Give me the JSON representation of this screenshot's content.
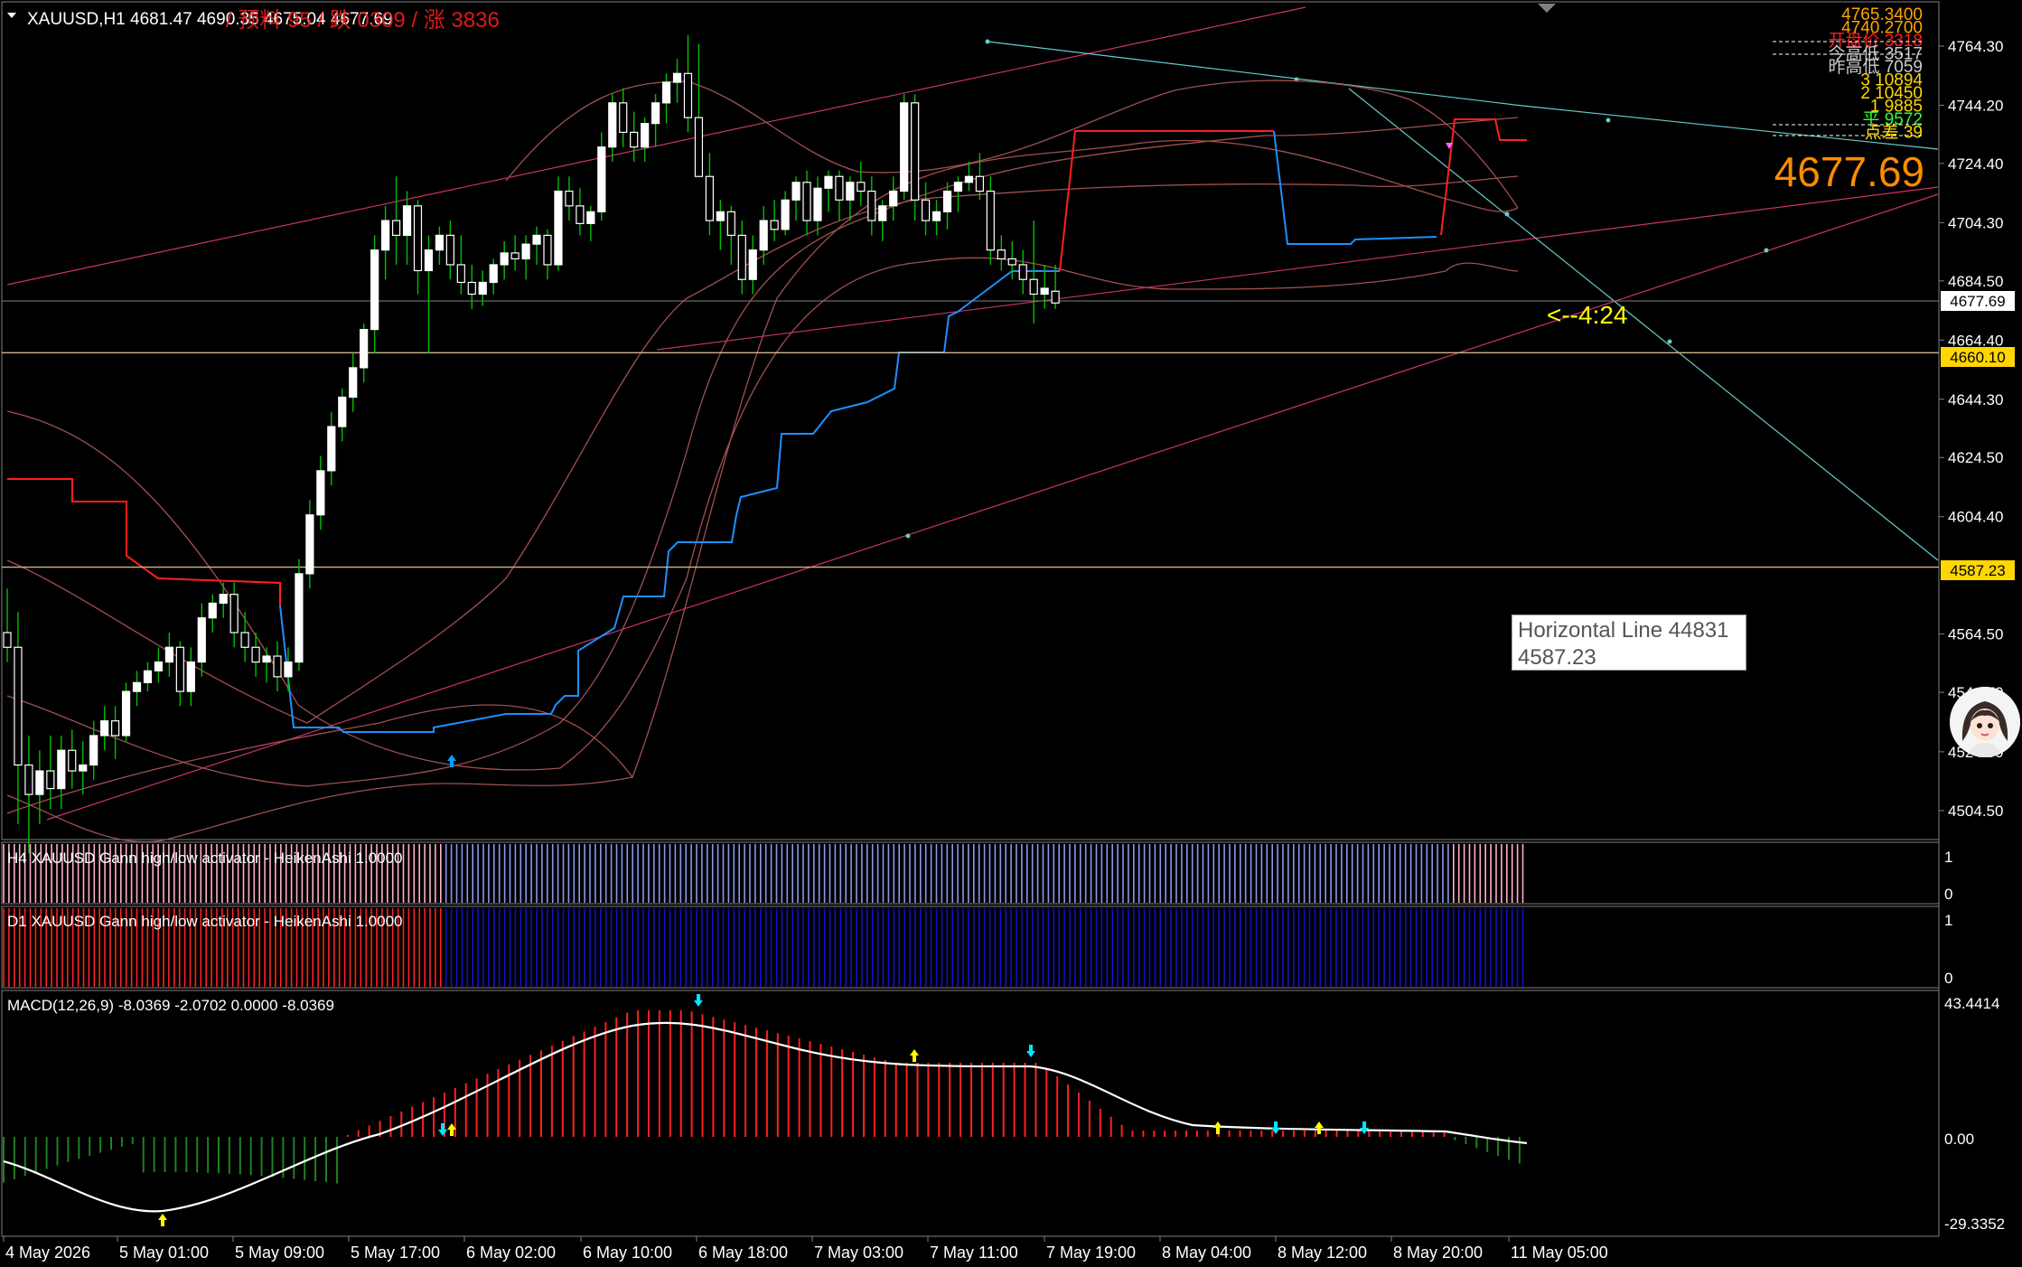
{
  "window": {
    "symbol_info": "XAUUSD,H1  4681.47 4690.35 4675.04 4677.69",
    "overlay_text_red": "/ 预料 95 / 跌 0309 / 涨 3836",
    "current_price_big": "4677.69",
    "countdown": "<--4:24"
  },
  "info_panel": {
    "lines": [
      {
        "text": "4765.3400",
        "color": "#ffa500"
      },
      {
        "text": "4740.2700",
        "color": "#ffa500"
      },
      {
        "text": "开盘价 3318",
        "color": "#ff2020"
      },
      {
        "text": "今高低 3517",
        "color": "#cccccc"
      },
      {
        "text": "昨高低 7059",
        "color": "#cccccc"
      },
      {
        "text": "3 10894",
        "color": "#ffd700"
      },
      {
        "text": "2 10450",
        "color": "#ffd700"
      },
      {
        "text": "1 9885",
        "color": "#ffd700"
      },
      {
        "text": "平 9572",
        "color": "#33ff33"
      },
      {
        "text": "点差 39",
        "color": "#ffd700"
      }
    ]
  },
  "price_axis": {
    "labels": [
      "4764.30",
      "4744.20",
      "4724.40",
      "4704.30",
      "4684.50",
      "4664.40",
      "4644.30",
      "4624.50",
      "4604.40",
      "4564.50",
      "4544.70",
      "4524.50",
      "4504.50"
    ],
    "current_tag": "4677.69",
    "hline1_tag": "4660.10",
    "hline2_tag": "4587.23"
  },
  "tooltip": {
    "line1": "Horizontal Line 44831",
    "line2": "4587.23"
  },
  "indicator_h4": {
    "label": "H4 XAUUSD Gann high/low activator - HeikenAshi 1.0000",
    "axis_top": "1",
    "axis_bottom": "0"
  },
  "indicator_d1": {
    "label": "D1 XAUUSD Gann high/low activator - HeikenAshi 1.0000",
    "axis_top": "1",
    "axis_bottom": "0"
  },
  "macd": {
    "label": "MACD(12,26,9) -8.0369 -2.0702 0.0000 -8.0369",
    "axis_top": "43.4414",
    "axis_mid": "0.00",
    "axis_bottom": "-29.3352"
  },
  "time_axis": [
    "4 May 2026",
    "5 May 01:00",
    "5 May 09:00",
    "5 May 17:00",
    "6 May 02:00",
    "6 May 10:00",
    "6 May 18:00",
    "7 May 03:00",
    "7 May 11:00",
    "7 May 19:00",
    "8 May 04:00",
    "8 May 12:00",
    "8 May 20:00",
    "11 May 05:00"
  ],
  "colors": {
    "bull": "#ffffff",
    "bear": "#ffffff",
    "wick": "#00c000",
    "red_line": "#ff2020",
    "blue_line": "#1e90ff",
    "boll": "#a05050",
    "grid_line": "#808080",
    "hline": "#d2b48c",
    "trend_pink": "#cc3366",
    "trend_cyan": "#66cccc",
    "macd_pos": "#ff2020",
    "macd_neg": "#208020"
  },
  "chart_data": {
    "type": "candlestick",
    "candles": [
      [
        4565,
        4580,
        4555,
        4560
      ],
      [
        4560,
        4572,
        4500,
        4520
      ],
      [
        4520,
        4530,
        4490,
        4510
      ],
      [
        4510,
        4525,
        4500,
        4518
      ],
      [
        4518,
        4530,
        4505,
        4512
      ],
      [
        4512,
        4530,
        4505,
        4525
      ],
      [
        4525,
        4532,
        4512,
        4518
      ],
      [
        4518,
        4528,
        4510,
        4520
      ],
      [
        4520,
        4535,
        4515,
        4530
      ],
      [
        4530,
        4540,
        4525,
        4535
      ],
      [
        4535,
        4540,
        4522,
        4530
      ],
      [
        4530,
        4548,
        4528,
        4545
      ],
      [
        4545,
        4552,
        4540,
        4548
      ],
      [
        4548,
        4555,
        4545,
        4552
      ],
      [
        4552,
        4560,
        4548,
        4555
      ],
      [
        4555,
        4565,
        4550,
        4560
      ],
      [
        4560,
        4562,
        4540,
        4545
      ],
      [
        4545,
        4560,
        4540,
        4555
      ],
      [
        4555,
        4575,
        4550,
        4570
      ],
      [
        4570,
        4578,
        4565,
        4575
      ],
      [
        4575,
        4582,
        4570,
        4578
      ],
      [
        4578,
        4582,
        4560,
        4565
      ],
      [
        4565,
        4572,
        4555,
        4560
      ],
      [
        4560,
        4565,
        4550,
        4555
      ],
      [
        4555,
        4560,
        4548,
        4557
      ],
      [
        4557,
        4562,
        4545,
        4550
      ],
      [
        4550,
        4560,
        4545,
        4555
      ],
      [
        4555,
        4590,
        4552,
        4585
      ],
      [
        4585,
        4610,
        4580,
        4605
      ],
      [
        4605,
        4625,
        4600,
        4620
      ],
      [
        4620,
        4640,
        4615,
        4635
      ],
      [
        4635,
        4648,
        4630,
        4645
      ],
      [
        4645,
        4660,
        4640,
        4655
      ],
      [
        4655,
        4670,
        4650,
        4668
      ],
      [
        4668,
        4700,
        4660,
        4695
      ],
      [
        4695,
        4710,
        4685,
        4705
      ],
      [
        4705,
        4720,
        4690,
        4700
      ],
      [
        4700,
        4715,
        4690,
        4710
      ],
      [
        4710,
        4712,
        4680,
        4688
      ],
      [
        4688,
        4700,
        4660,
        4695
      ],
      [
        4695,
        4703,
        4690,
        4700
      ],
      [
        4700,
        4705,
        4685,
        4690
      ],
      [
        4690,
        4700,
        4680,
        4684
      ],
      [
        4684,
        4690,
        4675,
        4680
      ],
      [
        4680,
        4688,
        4676,
        4684
      ],
      [
        4684,
        4692,
        4680,
        4690
      ],
      [
        4690,
        4698,
        4685,
        4694
      ],
      [
        4694,
        4700,
        4688,
        4692
      ],
      [
        4692,
        4700,
        4685,
        4697
      ],
      [
        4697,
        4703,
        4690,
        4700
      ],
      [
        4700,
        4702,
        4685,
        4690
      ],
      [
        4690,
        4720,
        4688,
        4715
      ],
      [
        4715,
        4720,
        4705,
        4710
      ],
      [
        4710,
        4716,
        4700,
        4704
      ],
      [
        4704,
        4710,
        4698,
        4708
      ],
      [
        4708,
        4735,
        4705,
        4730
      ],
      [
        4730,
        4748,
        4725,
        4745
      ],
      [
        4745,
        4750,
        4730,
        4735
      ],
      [
        4735,
        4742,
        4725,
        4730
      ],
      [
        4730,
        4740,
        4725,
        4738
      ],
      [
        4738,
        4748,
        4730,
        4745
      ],
      [
        4745,
        4755,
        4738,
        4752
      ],
      [
        4752,
        4760,
        4745,
        4755
      ],
      [
        4755,
        4768,
        4735,
        4740
      ],
      [
        4740,
        4765,
        4730,
        4720
      ],
      [
        4720,
        4728,
        4700,
        4705
      ],
      [
        4705,
        4712,
        4695,
        4708
      ],
      [
        4708,
        4710,
        4690,
        4700
      ],
      [
        4700,
        4705,
        4680,
        4685
      ],
      [
        4685,
        4700,
        4680,
        4695
      ],
      [
        4695,
        4710,
        4690,
        4705
      ],
      [
        4705,
        4712,
        4698,
        4702
      ],
      [
        4702,
        4715,
        4700,
        4712
      ],
      [
        4712,
        4720,
        4705,
        4718
      ],
      [
        4718,
        4722,
        4700,
        4705
      ],
      [
        4705,
        4720,
        4700,
        4716
      ],
      [
        4716,
        4722,
        4708,
        4720
      ],
      [
        4720,
        4722,
        4705,
        4712
      ],
      [
        4712,
        4720,
        4705,
        4718
      ],
      [
        4718,
        4725,
        4710,
        4715
      ],
      [
        4715,
        4720,
        4700,
        4705
      ],
      [
        4705,
        4712,
        4698,
        4710
      ],
      [
        4710,
        4720,
        4705,
        4715
      ],
      [
        4715,
        4748,
        4712,
        4745
      ],
      [
        4745,
        4748,
        4705,
        4712
      ],
      [
        4712,
        4718,
        4700,
        4705
      ],
      [
        4705,
        4712,
        4700,
        4708
      ],
      [
        4708,
        4718,
        4702,
        4715
      ],
      [
        4715,
        4720,
        4708,
        4718
      ],
      [
        4718,
        4725,
        4715,
        4720
      ],
      [
        4720,
        4728,
        4712,
        4715
      ],
      [
        4715,
        4720,
        4690,
        4695
      ],
      [
        4695,
        4700,
        4688,
        4692
      ],
      [
        4692,
        4698,
        4685,
        4690
      ],
      [
        4690,
        4695,
        4680,
        4685
      ],
      [
        4685,
        4705,
        4670,
        4680
      ],
      [
        4680,
        4690,
        4675,
        4682
      ],
      [
        4681,
        4690,
        4675,
        4677
      ]
    ],
    "horizontal_lines": [
      4660.1,
      4587.23,
      4677.69
    ]
  }
}
